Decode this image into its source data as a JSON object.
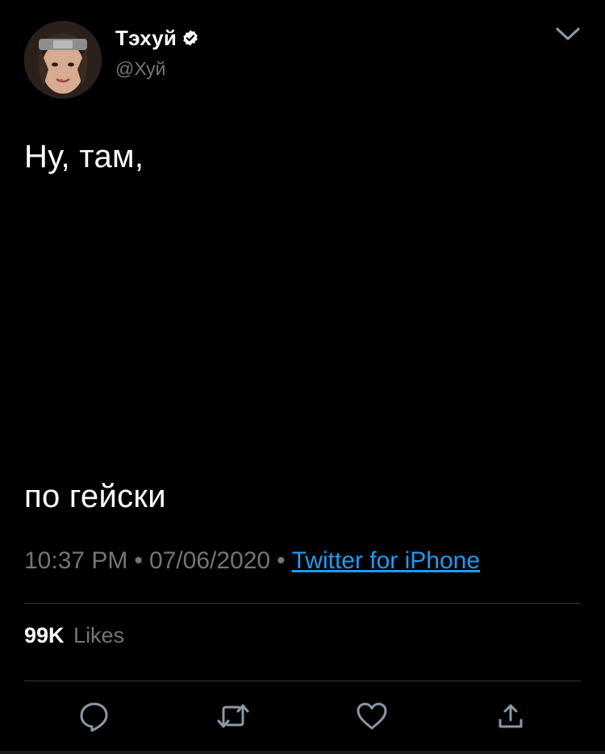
{
  "author": {
    "display_name": "Тэхуй",
    "handle": "@Хуй",
    "verified": true,
    "avatar_icon": "profile-photo"
  },
  "tweet": {
    "line1": "Ну, там,",
    "line2": "по гейски"
  },
  "meta": {
    "time": "10:37 PM",
    "separator": "•",
    "date": "07/06/2020",
    "source": "Twitter for iPhone"
  },
  "stats": {
    "likes_count": "99K",
    "likes_label": "Likes"
  },
  "actions": {
    "reply_icon": "reply-icon",
    "retweet_icon": "retweet-icon",
    "like_icon": "heart-icon",
    "share_icon": "share-icon"
  },
  "colors": {
    "background": "#000000",
    "text": "#ffffff",
    "secondary": "#71767b",
    "link": "#1d9bf0",
    "divider": "#2f3336"
  }
}
